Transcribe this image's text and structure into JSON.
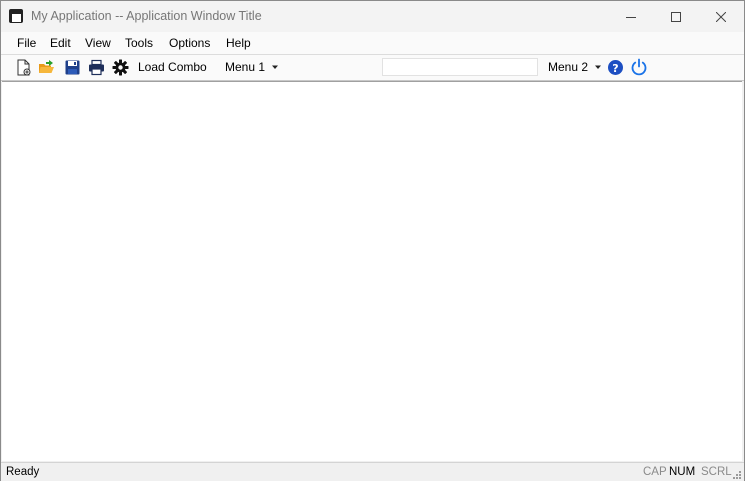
{
  "window": {
    "title": "My Application -- Application Window Title",
    "icons": {
      "app": "app-icon",
      "minimize": "minimize-icon",
      "maximize": "maximize-icon",
      "close": "close-icon"
    }
  },
  "menubar": {
    "items": [
      "File",
      "Edit",
      "View",
      "Tools",
      "Options",
      "Help"
    ]
  },
  "toolbar": {
    "icons": [
      "new-document-icon",
      "open-folder-icon",
      "save-icon",
      "print-icon",
      "gear-icon"
    ],
    "load_combo_label": "Load Combo",
    "menu1_label": "Menu 1",
    "search_value": "",
    "menu2_label": "Menu 2",
    "help_icon": "help-icon",
    "power_icon": "power-icon",
    "colors": {
      "help": "#1d4fc2",
      "power": "#1a73e8",
      "open_folder": "#f0a020",
      "open_arrow": "#2aa02a"
    }
  },
  "statusbar": {
    "text": "Ready",
    "indicators": [
      {
        "label": "CAP",
        "active": false
      },
      {
        "label": "NUM",
        "active": true
      },
      {
        "label": "SCRL",
        "active": false
      }
    ]
  }
}
